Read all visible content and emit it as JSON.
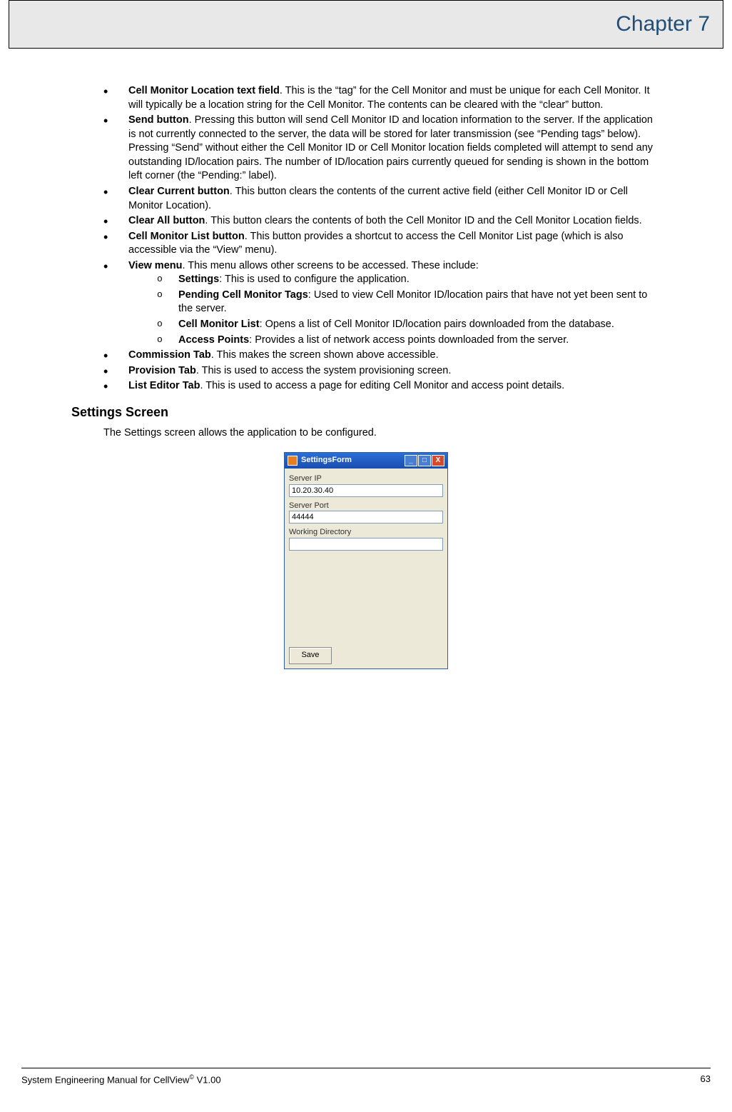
{
  "header": {
    "chapter": "Chapter 7"
  },
  "bullets": [
    {
      "term": "Cell Monitor Location text field",
      "text": ".  This is the “tag” for the Cell Monitor and must be unique for each Cell Monitor.  It will typically be a location string for the Cell Monitor.  The contents can be cleared with the “clear” button."
    },
    {
      "term": "Send button",
      "text": ".  Pressing this button will send Cell Monitor ID and location information to the server.  If the application is not currently connected to the server, the data will be stored for later transmission (see “Pending tags” below).  Pressing “Send” without either the Cell Monitor ID or Cell Monitor location fields completed will attempt to send any outstanding ID/location pairs.  The number of ID/location pairs currently queued for sending is shown in the bottom left corner (the “Pending:” label)."
    },
    {
      "term": "Clear Current button",
      "text": ".  This button clears the contents of the current active field (either Cell Monitor ID or Cell Monitor Location)."
    },
    {
      "term": "Clear All button",
      "text": ".  This button clears the contents of both the Cell Monitor ID and the Cell Monitor Location fields."
    },
    {
      "term": "Cell Monitor List button",
      "text": ".  This button provides a shortcut to access the Cell Monitor List page (which is also accessible via the “View” menu)."
    },
    {
      "term": "View menu",
      "text": ".  This menu allows other screens to be accessed.  These include:",
      "sub": [
        {
          "term": "Settings",
          "text": ":  This is used to configure the application."
        },
        {
          "term": "Pending Cell Monitor Tags",
          "text": ": Used to view Cell Monitor ID/location pairs that have not yet been sent to the server."
        },
        {
          "term": "Cell Monitor List",
          "text": ": Opens a list of Cell Monitor ID/location pairs downloaded from the database."
        },
        {
          "term": "Access Points",
          "text": ": Provides a list of network access points downloaded from the server."
        }
      ]
    },
    {
      "term": "Commission Tab",
      "text": ".  This makes the screen shown above accessible."
    },
    {
      "term": "Provision Tab",
      "text": ".  This is used to access the system provisioning screen."
    },
    {
      "term": "List Editor Tab",
      "text": ".  This is used to access a page for editing Cell Monitor and access point details."
    }
  ],
  "section": {
    "heading": "Settings Screen",
    "intro": "The Settings screen allows the application to be configured."
  },
  "settings_form": {
    "title": "SettingsForm",
    "server_ip_label": "Server IP",
    "server_ip_value": "10.20.30.40",
    "server_port_label": "Server Port",
    "server_port_value": "44444",
    "working_dir_label": "Working Directory",
    "working_dir_value": "",
    "save_label": "Save"
  },
  "footer": {
    "left_pre": "System Engineering Manual for CellView",
    "left_post": " V1.00",
    "page": "63"
  }
}
